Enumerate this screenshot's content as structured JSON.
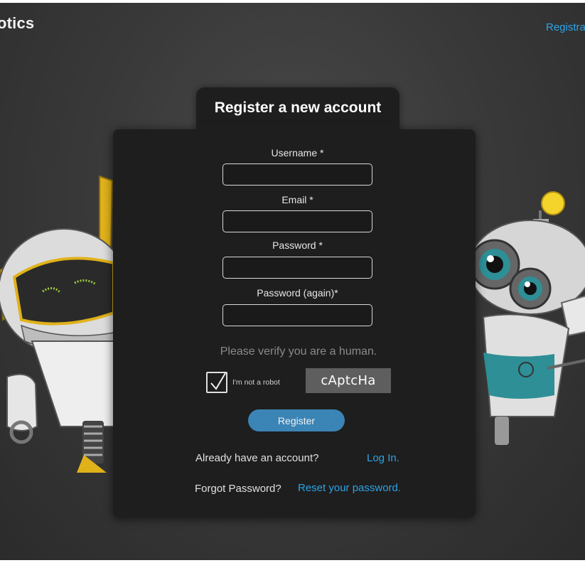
{
  "header": {
    "logo_text": "otics",
    "top_link": "Registration"
  },
  "form": {
    "title": "Register a new account",
    "fields": [
      {
        "label": "Username *",
        "value": ""
      },
      {
        "label": "Email *",
        "value": ""
      },
      {
        "label": "Password *",
        "value": ""
      },
      {
        "label": "Password (again)*",
        "value": ""
      }
    ],
    "verify_text": "Please verify you are a human.",
    "robot_label": "I'm not a robot",
    "captcha_text": "cAptcHa",
    "register_label": "Register",
    "login_prompt": "Already have an account?",
    "login_link": "Log In.",
    "forgot_prompt": "Forgot Password?",
    "reset_link": "Reset your password."
  },
  "colors": {
    "background": "#3a3a3a",
    "card": "#1e1e1e",
    "link": "#2ba3e6",
    "button": "#3b85b6"
  }
}
